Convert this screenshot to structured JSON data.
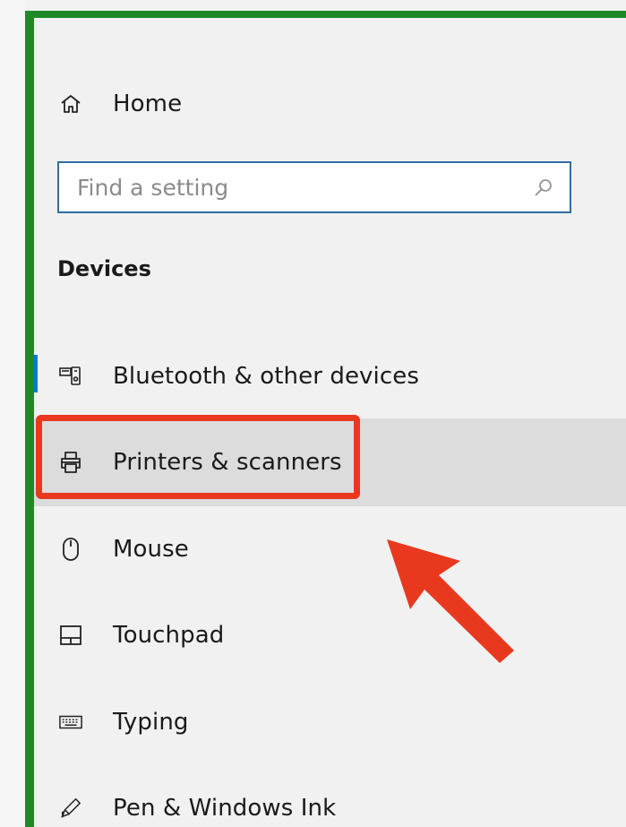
{
  "nav": {
    "home_label": "Home"
  },
  "search": {
    "placeholder": "Find a setting"
  },
  "section": {
    "title": "Devices"
  },
  "menu": {
    "items": [
      {
        "label": "Bluetooth & other devices",
        "icon": "bluetooth-devices-icon"
      },
      {
        "label": "Printers & scanners",
        "icon": "printer-icon"
      },
      {
        "label": "Mouse",
        "icon": "mouse-icon"
      },
      {
        "label": "Touchpad",
        "icon": "touchpad-icon"
      },
      {
        "label": "Typing",
        "icon": "keyboard-icon"
      },
      {
        "label": "Pen & Windows Ink",
        "icon": "pen-icon"
      }
    ]
  },
  "colors": {
    "frame_border": "#1e8a27",
    "highlight_box": "#e8391f",
    "annotation_arrow": "#e8391f",
    "search_border": "#2e6da4",
    "active_indicator": "#0078d7",
    "hover_row": "#dcdcdc"
  }
}
